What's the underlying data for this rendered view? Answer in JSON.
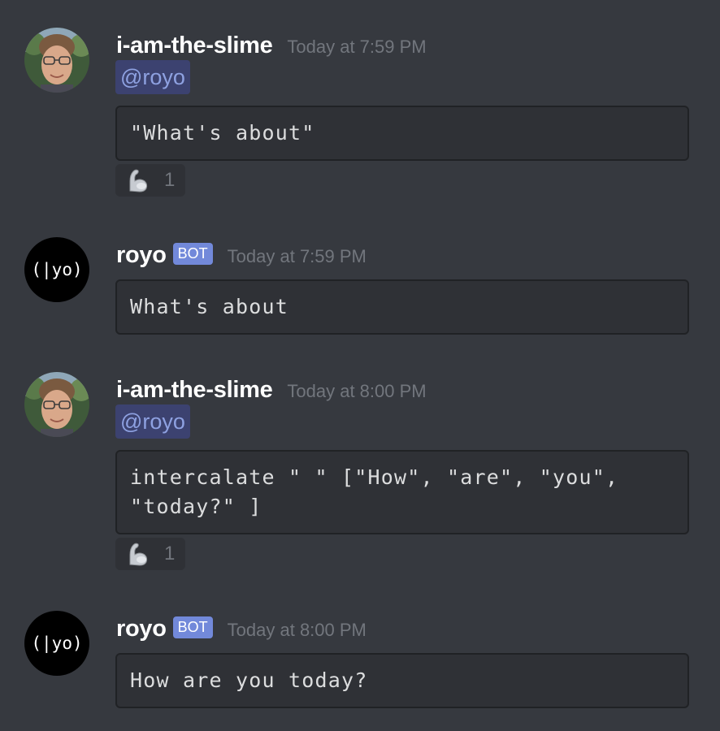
{
  "messages": [
    {
      "author": "i-am-the-slime",
      "timestamp": "Today at 7:59 PM",
      "mention": "@royo",
      "code": "\"What's about\"",
      "reaction": {
        "emoji": "flexed-biceps",
        "count": "1"
      }
    },
    {
      "author": "royo",
      "bot_tag": "BOT",
      "avatar_text": "(|yo)",
      "timestamp": "Today at 7:59 PM",
      "code": "What's about"
    },
    {
      "author": "i-am-the-slime",
      "timestamp": "Today at 8:00 PM",
      "mention": "@royo",
      "code": "intercalate \" \" [\"How\", \"are\", \"you\",\n\"today?\" ]",
      "reaction": {
        "emoji": "flexed-biceps",
        "count": "1"
      }
    },
    {
      "author": "royo",
      "bot_tag": "BOT",
      "avatar_text": "(|yo)",
      "timestamp": "Today at 8:00 PM",
      "code": "How are you today?"
    }
  ],
  "colors": {
    "background": "#36393f",
    "codeblock_bg": "#2f3136",
    "mention_bg": "#3c4270",
    "mention_text": "#8ea1e1",
    "bot_tag": "#7289da",
    "timestamp": "#72767d"
  }
}
